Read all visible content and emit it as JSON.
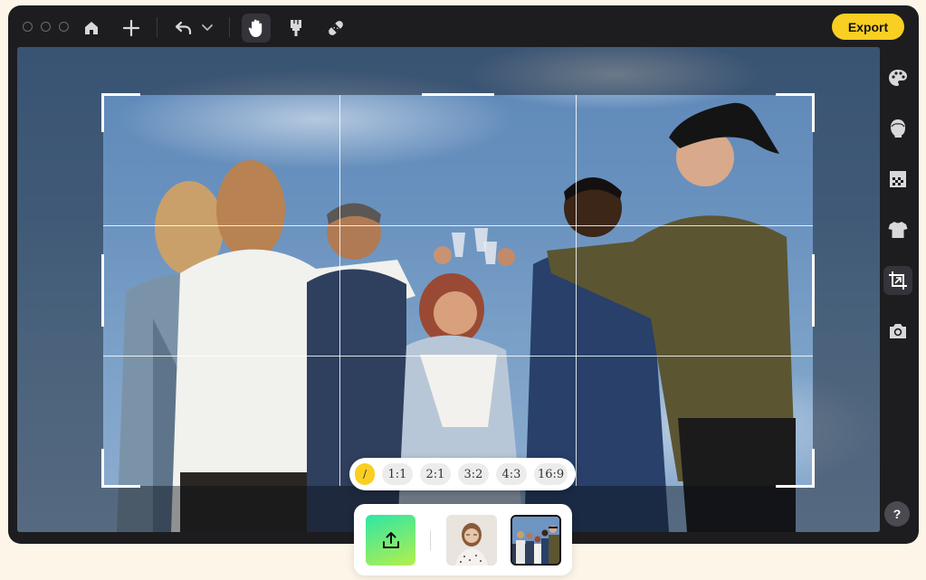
{
  "toolbar": {
    "window_controls": [
      "close",
      "minimize",
      "maximize"
    ],
    "icons": [
      "home-icon",
      "plus-icon",
      "undo-icon",
      "chevron-down-icon",
      "hand-tool-icon",
      "paint-brush-icon",
      "bandage-icon"
    ],
    "active_tool": "hand-tool-icon",
    "export_label": "Export"
  },
  "crop": {
    "ratios": [
      "/",
      "1:1",
      "2:1",
      "3:2",
      "4:3",
      "16:9"
    ],
    "active_ratio": "/"
  },
  "sidebar": {
    "icons": [
      "palette-icon",
      "face-icon",
      "transparency-icon",
      "tshirt-icon",
      "crop-icon",
      "camera-icon"
    ],
    "active": "crop-icon",
    "help_label": "?"
  },
  "tray": {
    "items": [
      "upload-icon",
      "portrait-thumbnail",
      "group-photo-thumbnail"
    ],
    "selected": "group-photo-thumbnail"
  },
  "colors": {
    "accent": "#f9cf21",
    "window_bg": "#1d1d20",
    "page_bg": "#fdf6e8"
  }
}
